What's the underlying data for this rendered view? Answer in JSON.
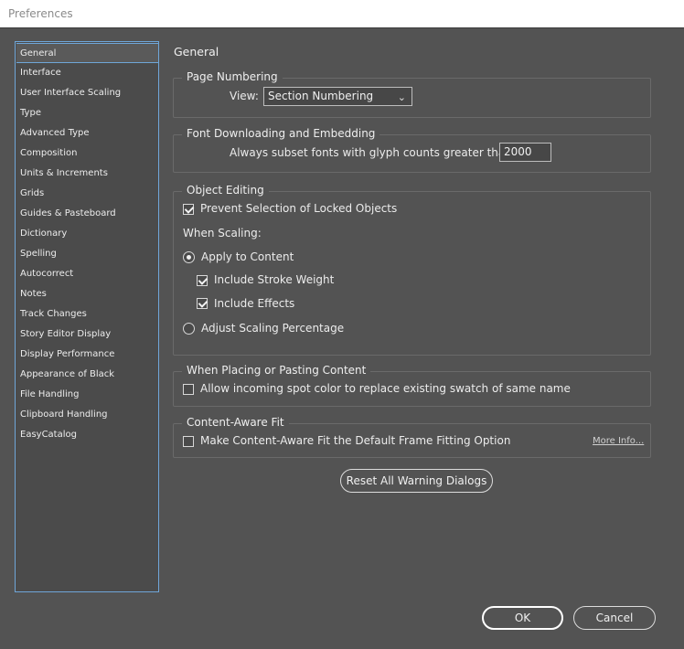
{
  "window": {
    "title": "Preferences"
  },
  "sidebar": {
    "items": [
      {
        "label": "General",
        "selected": true
      },
      {
        "label": "Interface"
      },
      {
        "label": "User Interface Scaling"
      },
      {
        "label": "Type"
      },
      {
        "label": "Advanced Type"
      },
      {
        "label": "Composition"
      },
      {
        "label": "Units & Increments"
      },
      {
        "label": "Grids"
      },
      {
        "label": "Guides & Pasteboard"
      },
      {
        "label": "Dictionary"
      },
      {
        "label": "Spelling"
      },
      {
        "label": "Autocorrect"
      },
      {
        "label": "Notes"
      },
      {
        "label": "Track Changes"
      },
      {
        "label": "Story Editor Display"
      },
      {
        "label": "Display Performance"
      },
      {
        "label": "Appearance of Black"
      },
      {
        "label": "File Handling"
      },
      {
        "label": "Clipboard Handling"
      },
      {
        "label": "EasyCatalog"
      }
    ]
  },
  "main": {
    "section_title": "General",
    "page_numbering": {
      "legend": "Page Numbering",
      "view_label": "View:",
      "view_value": "Section Numbering"
    },
    "font_downloading": {
      "legend": "Font Downloading and Embedding",
      "subset_label": "Always subset fonts with glyph counts greater than:",
      "subset_value": "2000"
    },
    "object_editing": {
      "legend": "Object Editing",
      "prevent_selection_label": "Prevent Selection of Locked Objects",
      "prevent_selection_checked": true,
      "when_scaling_label": "When Scaling:",
      "apply_to_content_label": "Apply to Content",
      "apply_to_content_selected": true,
      "include_stroke_label": "Include Stroke Weight",
      "include_stroke_checked": true,
      "include_effects_label": "Include Effects",
      "include_effects_checked": true,
      "adjust_scaling_label": "Adjust Scaling Percentage",
      "adjust_scaling_selected": false
    },
    "placing_pasting": {
      "legend": "When Placing or Pasting Content",
      "spot_color_label": "Allow incoming spot color to replace existing swatch of same name",
      "spot_color_checked": false
    },
    "content_aware_fit": {
      "legend": "Content-Aware Fit",
      "default_fitting_label": "Make Content-Aware Fit the Default Frame Fitting Option",
      "default_fitting_checked": false,
      "more_info_label": "More Info..."
    },
    "reset_warnings_label": "Reset All Warning Dialogs"
  },
  "footer": {
    "ok_label": "OK",
    "cancel_label": "Cancel"
  },
  "icons": {
    "dropdown": "chevron-down-icon"
  },
  "colors": {
    "background": "#535353",
    "sidebar_bg": "#4b4b4b",
    "selection_border": "#6fa6d8",
    "text": "#e6e6e6"
  }
}
